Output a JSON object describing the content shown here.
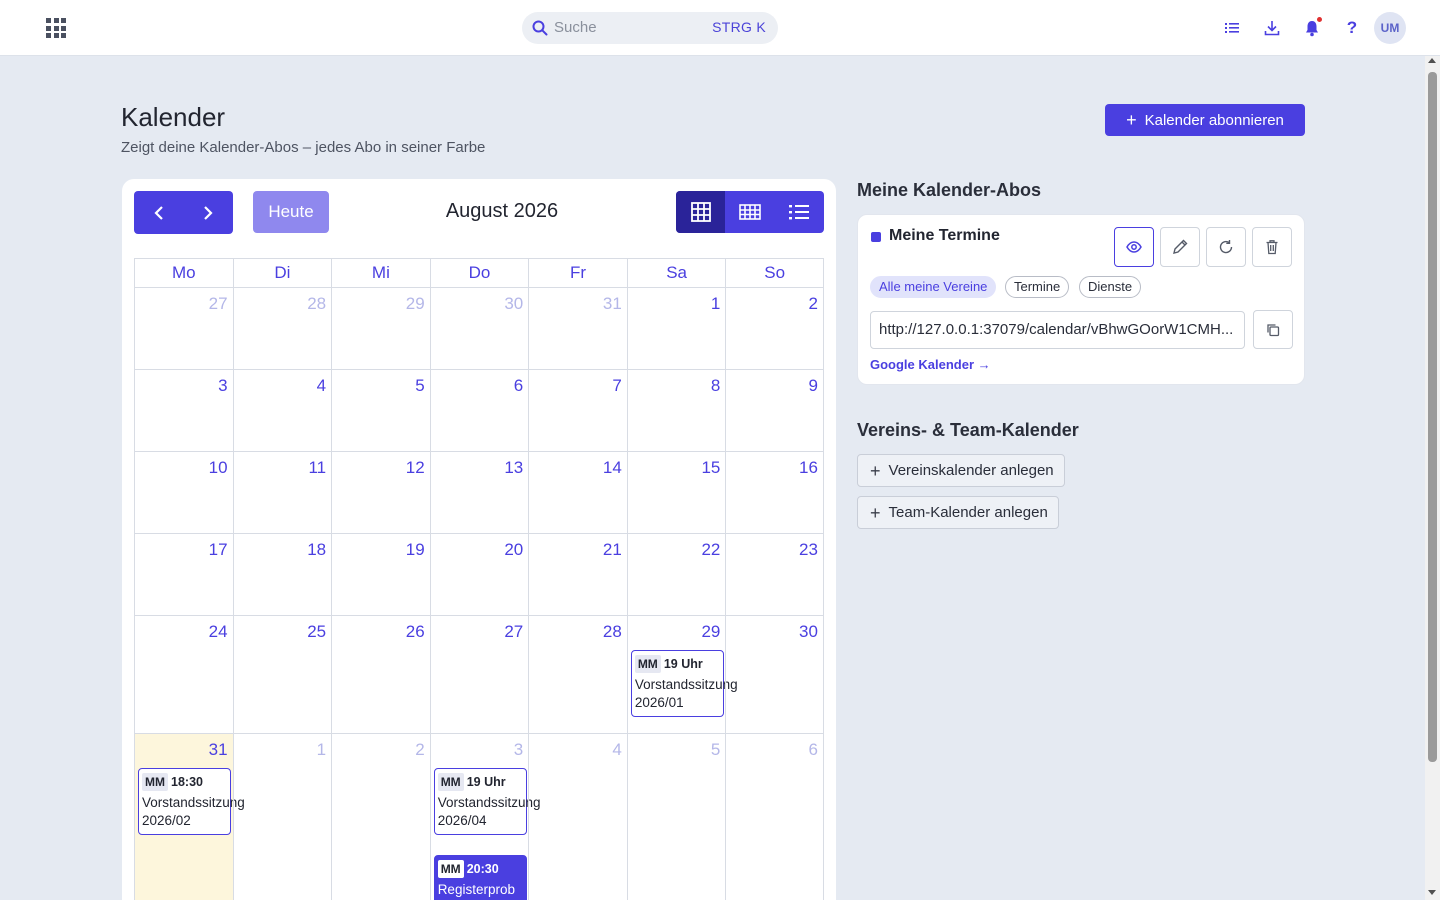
{
  "topbar": {
    "search_placeholder": "Suche",
    "search_shortcut": "STRG K",
    "avatar_initials": "UM",
    "help_label": "?",
    "icons": [
      "apps-grid-icon",
      "search-icon",
      "list-icon",
      "download-icon",
      "bell-icon",
      "help-icon"
    ]
  },
  "header": {
    "title": "Kalender",
    "subtitle": "Zeigt deine Kalender-Abos – jedes Abo in seiner Farbe",
    "subscribe_button": "Kalender abonnieren"
  },
  "calendar": {
    "today_button": "Heute",
    "month_label": "August 2026",
    "weekdays": [
      "Mo",
      "Di",
      "Mi",
      "Do",
      "Fr",
      "Sa",
      "So"
    ],
    "weeks": [
      [
        "27",
        "28",
        "29",
        "30",
        "31",
        "1",
        "2"
      ],
      [
        "3",
        "4",
        "5",
        "6",
        "7",
        "8",
        "9"
      ],
      [
        "10",
        "11",
        "12",
        "13",
        "14",
        "15",
        "16"
      ],
      [
        "17",
        "18",
        "19",
        "20",
        "21",
        "22",
        "23"
      ],
      [
        "24",
        "25",
        "26",
        "27",
        "28",
        "29",
        "30"
      ],
      [
        "31",
        "1",
        "2",
        "3",
        "4",
        "5",
        "6"
      ]
    ],
    "events": [
      {
        "badge": "MM",
        "time": "19 Uhr",
        "title": "Vorstandssitzung 2026/01"
      },
      {
        "badge": "MM",
        "time": "18:30",
        "title": "Vorstandssitzung 2026/02"
      },
      {
        "badge": "MM",
        "time": "19 Uhr",
        "title": "Vorstandssitzung 2026/04"
      },
      {
        "badge": "MM",
        "time": "20:30",
        "title": "Registerprob"
      }
    ],
    "colors": {
      "accent": "#4a3fe0",
      "today_bg": "#fdf6dc"
    }
  },
  "subscriptions": {
    "section_title": "Meine Kalender-Abos",
    "card": {
      "name": "Meine Termine",
      "chips": [
        "Alle meine Vereine",
        "Termine",
        "Dienste"
      ],
      "url": "http://127.0.0.1:37079/calendar/vBhwGOorW1CMH...",
      "google_link": "Google Kalender →"
    }
  },
  "club_calendars": {
    "section_title": "Vereins- & Team-Kalender",
    "create_club_button": "Vereinskalender anlegen",
    "create_team_button": "Team-Kalender anlegen"
  }
}
